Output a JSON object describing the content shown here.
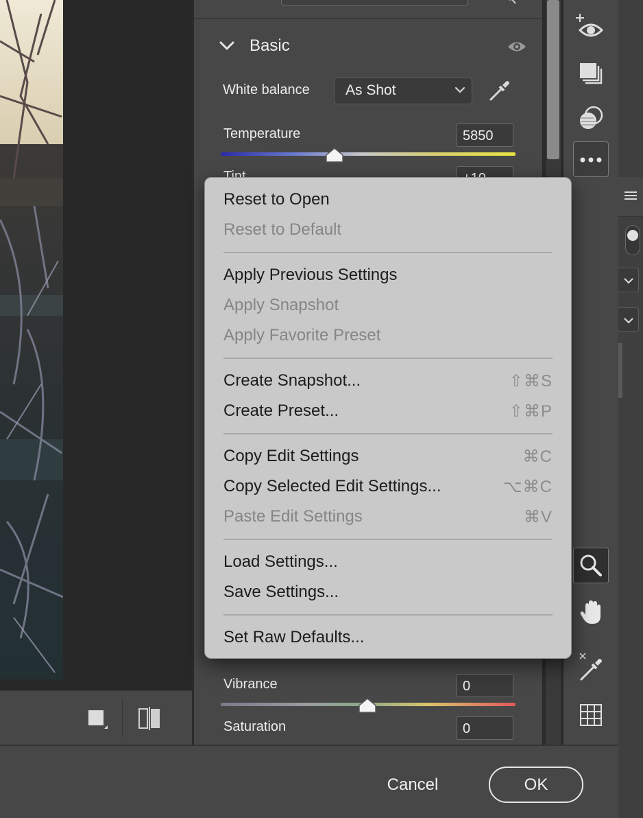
{
  "panel": {
    "section_title": "Basic",
    "white_balance": {
      "label": "White balance",
      "value": "As Shot"
    },
    "temperature": {
      "label": "Temperature",
      "value": "5850"
    },
    "tint": {
      "label": "Tint",
      "value": "+10"
    },
    "vibrance": {
      "label": "Vibrance",
      "value": "0"
    },
    "saturation": {
      "label": "Saturation",
      "value": "0"
    }
  },
  "context_menu": {
    "groups": [
      [
        {
          "label": "Reset to Open",
          "shortcut": "",
          "enabled": true
        },
        {
          "label": "Reset to Default",
          "shortcut": "",
          "enabled": false
        }
      ],
      [
        {
          "label": "Apply Previous Settings",
          "shortcut": "",
          "enabled": true
        },
        {
          "label": "Apply Snapshot",
          "shortcut": "",
          "enabled": false
        },
        {
          "label": "Apply Favorite Preset",
          "shortcut": "",
          "enabled": false
        }
      ],
      [
        {
          "label": "Create Snapshot...",
          "shortcut": "⇧⌘S",
          "enabled": true
        },
        {
          "label": "Create Preset...",
          "shortcut": "⇧⌘P",
          "enabled": true
        }
      ],
      [
        {
          "label": "Copy Edit Settings",
          "shortcut": "⌘C",
          "enabled": true
        },
        {
          "label": "Copy Selected Edit Settings...",
          "shortcut": "⌥⌘C",
          "enabled": true
        },
        {
          "label": "Paste Edit Settings",
          "shortcut": "⌘V",
          "enabled": false
        }
      ],
      [
        {
          "label": "Load Settings...",
          "shortcut": "",
          "enabled": true
        },
        {
          "label": "Save Settings...",
          "shortcut": "",
          "enabled": true
        }
      ],
      [
        {
          "label": "Set Raw Defaults...",
          "shortcut": "",
          "enabled": true
        }
      ]
    ]
  },
  "footer": {
    "cancel_label": "Cancel",
    "ok_label": "OK"
  },
  "icons": {
    "chevron": "chevron-down-icon",
    "eye": "eye-icon",
    "eyedropper": "eyedropper-icon",
    "zoom": "zoom-icon",
    "hand": "hand-icon",
    "grid": "grid-icon",
    "more": "more-icon"
  }
}
